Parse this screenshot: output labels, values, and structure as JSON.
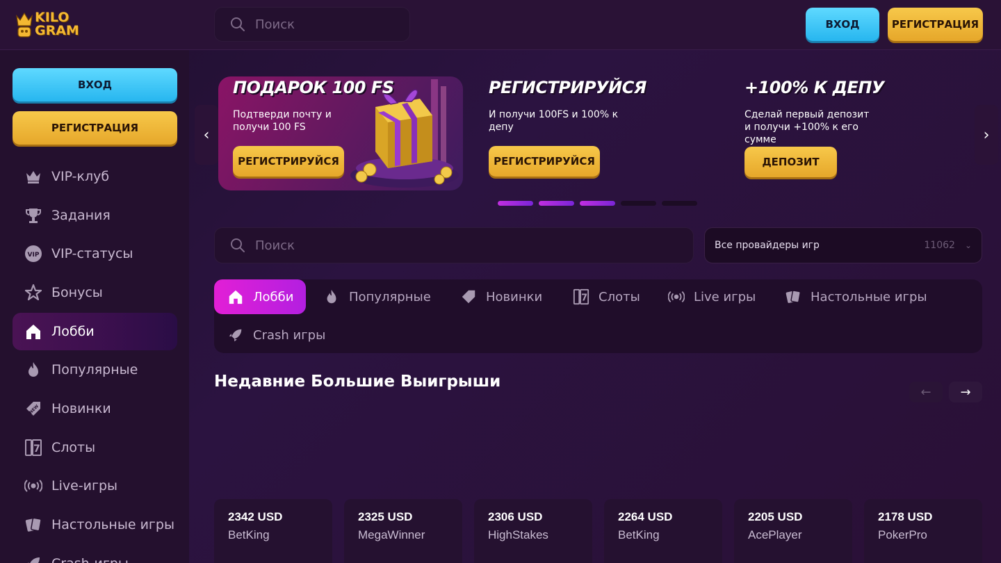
{
  "header": {
    "logo_line1": "KILO",
    "logo_line2": "GRAM",
    "search_placeholder": "Поиск",
    "login_label": "ВХОД",
    "register_label": "РЕГИСТРАЦИЯ"
  },
  "sidebar": {
    "login_label": "ВХОД",
    "register_label": "РЕГИСТРАЦИЯ",
    "items": [
      {
        "label": "VIP-клуб",
        "icon": "crown-icon"
      },
      {
        "label": "Задания",
        "icon": "trophy-icon"
      },
      {
        "label": "VIP-статусы",
        "icon": "vip-badge-icon"
      },
      {
        "label": "Бонусы",
        "icon": "star-icon"
      },
      {
        "label": "Лобби",
        "icon": "home-icon",
        "active": true
      },
      {
        "label": "Популярные",
        "icon": "flame-icon"
      },
      {
        "label": "Новинки",
        "icon": "new-tag-icon"
      },
      {
        "label": "Слоты",
        "icon": "slot-icon"
      },
      {
        "label": "Live-игры",
        "icon": "broadcast-icon"
      },
      {
        "label": "Настольные игры",
        "icon": "cards-icon"
      },
      {
        "label": "Crash-игры",
        "icon": "rocket-icon"
      }
    ]
  },
  "banners": [
    {
      "title": "ПОДАРОК 100 FS",
      "text": "Подтверди почту и получи 100 FS",
      "button": "РЕГИСТРИРУЙСЯ"
    },
    {
      "title": "РЕГИСТРИРУЙСЯ",
      "text": "И получи 100FS и 100% к депу",
      "button": "РЕГИСТРИРУЙСЯ"
    },
    {
      "title": "+100% К ДЕПУ",
      "text": "Сделай первый депозит и получи +100% к его сумме",
      "button": "ДЕПОЗИТ"
    }
  ],
  "carousel": {
    "total_dots": 5,
    "active_dots": 3
  },
  "search": {
    "placeholder": "Поиск",
    "providers_label": "Все провайдеры игр",
    "providers_count": "11062"
  },
  "tabs": [
    {
      "label": "Лобби",
      "icon": "home-icon",
      "active": true
    },
    {
      "label": "Популярные",
      "icon": "flame-icon"
    },
    {
      "label": "Новинки",
      "icon": "new-tag-icon"
    },
    {
      "label": "Слоты",
      "icon": "slot-icon"
    },
    {
      "label": "Live игры",
      "icon": "broadcast-icon"
    },
    {
      "label": "Настольные игры",
      "icon": "cards-icon"
    },
    {
      "label": "Crash игры",
      "icon": "rocket-icon"
    }
  ],
  "big_wins": {
    "title": "Недавние Большие Выигрыши",
    "items": [
      {
        "amount": "2342 USD",
        "user": "BetKing"
      },
      {
        "amount": "2325 USD",
        "user": "MegaWinner"
      },
      {
        "amount": "2306 USD",
        "user": "HighStakes"
      },
      {
        "amount": "2264 USD",
        "user": "BetKing"
      },
      {
        "amount": "2205 USD",
        "user": "AcePlayer"
      },
      {
        "amount": "2178 USD",
        "user": "PokerPro"
      }
    ]
  },
  "colors": {
    "accent_pink": "#e21fd6",
    "gold": "#f4b832",
    "blue": "#27b6ef",
    "background": "#2a1236"
  }
}
